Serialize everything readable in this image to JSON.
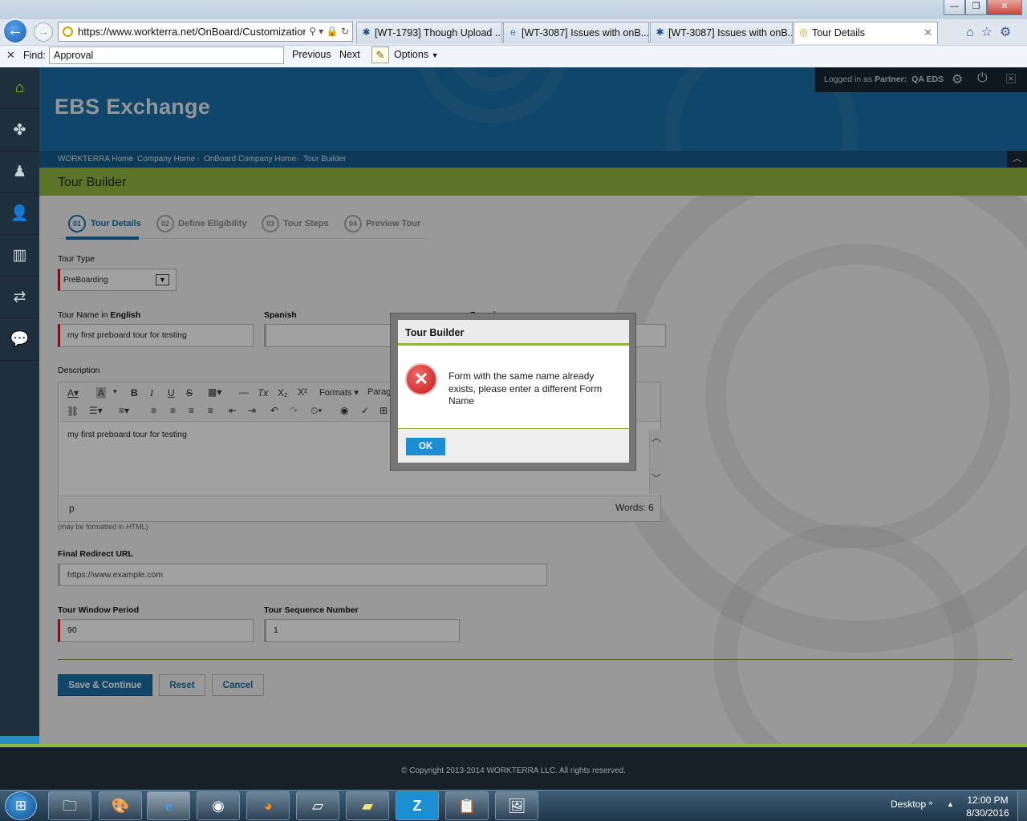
{
  "browser": {
    "address": "https://www.workterra.net/OnBoard/Customizatior",
    "address_icons": "⚲ ▾ 🔒 ↻",
    "tabs": [
      {
        "label": "[WT-1793] Though Upload ...",
        "icon": "jira-icon"
      },
      {
        "label": "[WT-3087] Issues with onB...",
        "icon": "ie-icon"
      },
      {
        "label": "[WT-3087] Issues with onB...",
        "icon": "jira-icon"
      },
      {
        "label": "Tour Details",
        "icon": "site-icon",
        "active": true
      }
    ],
    "window_buttons": [
      "—",
      "❐",
      "✕"
    ],
    "find": {
      "close": "✕",
      "label": "Find:",
      "value": "Approval",
      "previous": "Previous",
      "next": "Next",
      "options": "Options"
    }
  },
  "header": {
    "brand": "EBS Exchange",
    "logged_in_prefix": "Logged in as ",
    "partner_label": "Partner:",
    "partner_name": "QA EDS"
  },
  "breadcrumbs": [
    "WORKTERRA Home",
    "Company Home",
    "OnBoard Company Home",
    "Tour Builder"
  ],
  "page": {
    "title": "Tour Builder",
    "steps": [
      {
        "num": "01",
        "label": "Tour Details",
        "active": true
      },
      {
        "num": "02",
        "label": "Define Eligibility"
      },
      {
        "num": "03",
        "label": "Tour Steps"
      },
      {
        "num": "04",
        "label": "Preview Tour"
      }
    ]
  },
  "form": {
    "tour_type_label": "Tour Type",
    "tour_type_value": "PreBoarding",
    "tour_name_label_prefix": "Tour Name in ",
    "tour_name_label_lang": "English",
    "tour_name_value": "my first preboard tour for testing",
    "spanish_label": "Spanish",
    "french_label": "French",
    "description_label": "Description",
    "toolbar_formats": "Formats",
    "toolbar_paragraph": "Paragra",
    "description_value": "my first preboard tour for testing",
    "editor_path": "p",
    "editor_words": "Words: 6",
    "html_note": "(may be formatted in HTML)",
    "redirect_label": "Final Redirect URL",
    "redirect_placeholder": "https://www.example.com",
    "window_label": "Tour Window Period",
    "window_value": "90",
    "sequence_label": "Tour Sequence Number",
    "sequence_value": "1",
    "save_button": "Save & Continue",
    "reset_button": "Reset",
    "cancel_button": "Cancel"
  },
  "dialog": {
    "title": "Tour Builder",
    "message": "Form with the same name already exists, please enter a different Form Name",
    "ok": "OK"
  },
  "footer": {
    "copyright": "© Copyright 2013-2014 WORKTERRA LLC. All rights reserved."
  },
  "taskbar": {
    "desktop": "Desktop",
    "time": "12:00 PM",
    "date": "8/30/2016"
  },
  "colors": {
    "header_blue": "#1a6fa6",
    "title_green": "#90b840",
    "sidebar_dark": "#1f2f3d",
    "error_red": "#c41a1a",
    "ok_blue": "#1e8ed4"
  }
}
